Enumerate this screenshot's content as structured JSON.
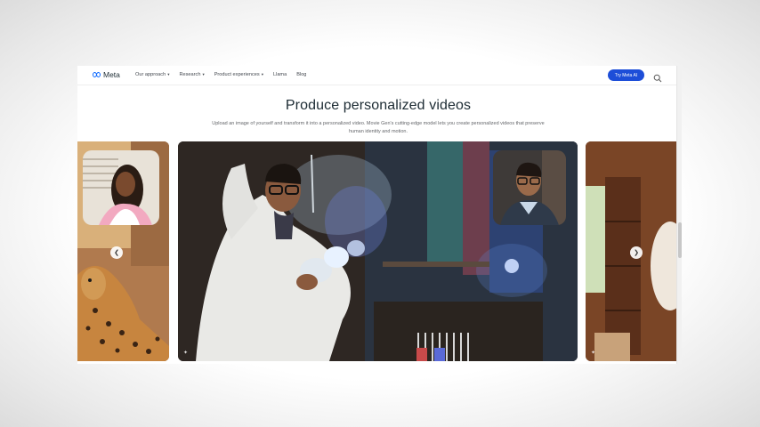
{
  "nav": {
    "logo_text": "Meta",
    "links": [
      {
        "label": "Our approach",
        "has_dropdown": true
      },
      {
        "label": "Research",
        "has_dropdown": true
      },
      {
        "label": "Product experiences",
        "has_dropdown": true
      },
      {
        "label": "Llama",
        "has_dropdown": false
      },
      {
        "label": "Blog",
        "has_dropdown": false
      }
    ],
    "cta_label": "Try Meta AI",
    "search_icon": "search-icon",
    "caret_icon": "chevron-down-icon",
    "colors": {
      "cta": "#1d4ed8",
      "text": "#1c2b33"
    }
  },
  "hero": {
    "title": "Produce personalized videos",
    "subtitle": "Upload an image of yourself and transform it into a personalized video. Movie Gen's cutting-edge model lets you create personalized videos that preserve human identity and motion."
  },
  "carousel": {
    "prev_icon": "chevron-left-icon",
    "next_icon": "chevron-right-icon",
    "cards": [
      {
        "id": "left",
        "thumbnail": "woman-portrait",
        "scene": "cheetah"
      },
      {
        "id": "main",
        "thumbnail": "man-portrait",
        "scene": "scientist-lab"
      },
      {
        "id": "right",
        "scene": "room"
      }
    ]
  }
}
